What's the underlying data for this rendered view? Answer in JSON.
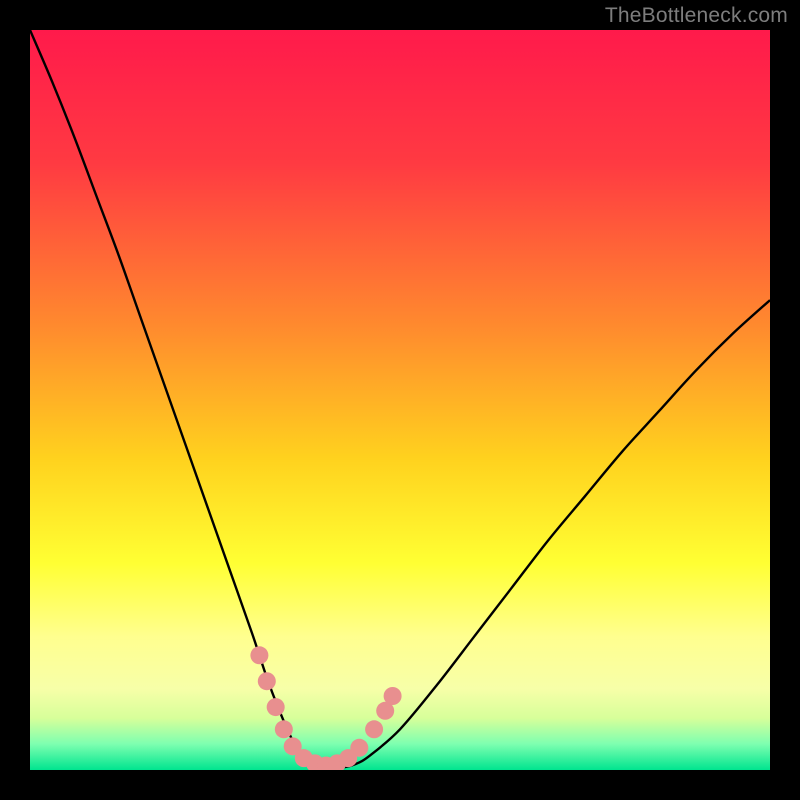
{
  "watermark": "TheBottleneck.com",
  "chart_data": {
    "type": "line",
    "title": "",
    "xlabel": "",
    "ylabel": "",
    "xlim": [
      0,
      100
    ],
    "ylim": [
      0,
      100
    ],
    "background_gradient": {
      "stops": [
        {
          "offset": 0.0,
          "color": "#ff1a4b"
        },
        {
          "offset": 0.18,
          "color": "#ff3a42"
        },
        {
          "offset": 0.4,
          "color": "#ff8a2e"
        },
        {
          "offset": 0.58,
          "color": "#ffd21e"
        },
        {
          "offset": 0.72,
          "color": "#ffff33"
        },
        {
          "offset": 0.82,
          "color": "#ffff8f"
        },
        {
          "offset": 0.89,
          "color": "#f7ffa8"
        },
        {
          "offset": 0.93,
          "color": "#d7ff9a"
        },
        {
          "offset": 0.965,
          "color": "#7dffb0"
        },
        {
          "offset": 1.0,
          "color": "#00e58f"
        }
      ]
    },
    "series": [
      {
        "name": "bottleneck-curve",
        "color": "#000000",
        "x": [
          0,
          3,
          6,
          9,
          12,
          15,
          18,
          21,
          24,
          27,
          30,
          32,
          33.5,
          35,
          36,
          37,
          38.5,
          40,
          42,
          44,
          46,
          50,
          55,
          60,
          65,
          70,
          75,
          80,
          85,
          90,
          95,
          100
        ],
        "y": [
          100,
          93,
          85.5,
          77.5,
          69.5,
          61,
          52.5,
          44,
          35.5,
          27,
          18.5,
          12.5,
          8.5,
          5,
          3,
          1.5,
          0.7,
          0.3,
          0.3,
          0.8,
          2,
          5.5,
          11.5,
          18,
          24.5,
          31,
          37,
          43,
          48.5,
          54,
          59,
          63.5
        ]
      }
    ],
    "markers": {
      "name": "highlight-dots",
      "color": "#e88f8f",
      "points": [
        {
          "x": 31.0,
          "y": 15.5
        },
        {
          "x": 32.0,
          "y": 12.0
        },
        {
          "x": 33.2,
          "y": 8.5
        },
        {
          "x": 34.3,
          "y": 5.5
        },
        {
          "x": 35.5,
          "y": 3.2
        },
        {
          "x": 37.0,
          "y": 1.6
        },
        {
          "x": 38.5,
          "y": 0.9
        },
        {
          "x": 40.0,
          "y": 0.6
        },
        {
          "x": 41.5,
          "y": 0.9
        },
        {
          "x": 43.0,
          "y": 1.6
        },
        {
          "x": 44.5,
          "y": 3.0
        },
        {
          "x": 46.5,
          "y": 5.5
        },
        {
          "x": 48.0,
          "y": 8.0
        },
        {
          "x": 49.0,
          "y": 10.0
        }
      ]
    }
  }
}
